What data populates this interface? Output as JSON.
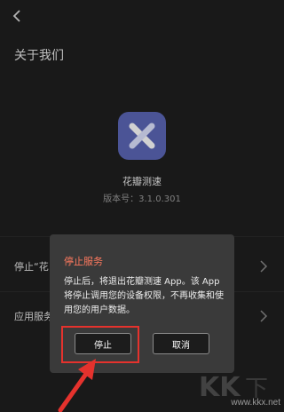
{
  "header": {
    "title": "关于我们",
    "back_icon": "chevron-left-icon"
  },
  "app": {
    "name": "花瓣测速",
    "version": "版本号：3.1.0.301",
    "icon": "app-x-logo-icon",
    "icon_color": "#5c67b8"
  },
  "menu": {
    "items": [
      {
        "label": "停止“花",
        "chevron": "chevron-right-icon"
      },
      {
        "label": "应用服务",
        "chevron": "chevron-right-icon"
      }
    ]
  },
  "dialog": {
    "title": "停止服务",
    "message": "停止后，将退出花瓣测速 App。该 App 将停止调用您的设备权限，不再收集和使用您的用户数据。",
    "confirm_label": "停止",
    "cancel_label": "取消",
    "title_color": "#ff7a5f"
  },
  "annotation": {
    "highlight_color": "#e5322d"
  },
  "watermark": {
    "text": "www.kkx.net"
  }
}
